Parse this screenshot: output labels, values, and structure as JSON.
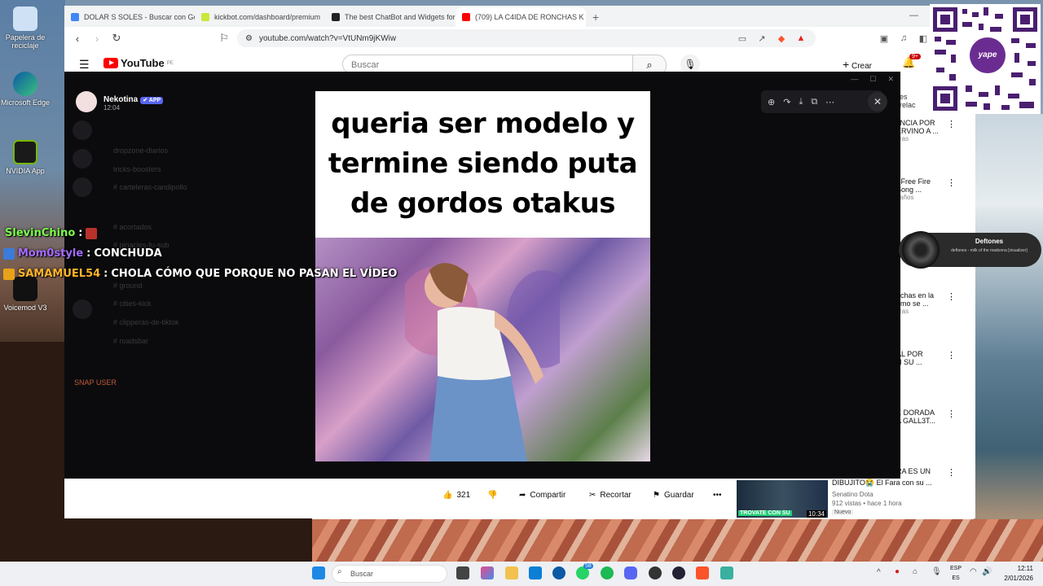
{
  "desktop": {
    "icons": [
      {
        "label": "Papelera de reciclaje"
      },
      {
        "label": "Microsoft Edge"
      },
      {
        "label": "NVIDIA App"
      },
      {
        "label": "Voicemod V3"
      }
    ]
  },
  "browser": {
    "tabs": [
      {
        "label": "DOLAR S SOLES - Buscar con Google",
        "color": "#4285f4"
      },
      {
        "label": "kickbot.com/dashboard/premium",
        "color": "#c8e83a"
      },
      {
        "label": "The best ChatBot and Widgets for K",
        "color": "#222222"
      },
      {
        "label": "(709) LA C4IDA DE RONCHAS K",
        "color": "#ff0000"
      }
    ],
    "new_tab": "+",
    "url": "youtube.com/watch?v=VtUNm9jKWiw"
  },
  "youtube": {
    "logo": "YouTube",
    "region": "PE",
    "search_placeholder": "Buscar",
    "create_label": "Crear",
    "bell_badge": "9+",
    "actions": {
      "likes": "321",
      "share": "Compartir",
      "clip": "Recortar",
      "save": "Guardar"
    },
    "recommendations": [
      {
        "title": "JNCIA POR\nERVINO A ...",
        "sub": "ras"
      },
      {
        "title": "- Free Fire\nSong ...",
        "sub": "años"
      },
      {
        "title": "nchas en la\nómo se ...",
        "sub": "ras"
      },
      {
        "title": "AL POR\nN SU ...",
        "sub": ""
      },
      {
        "title": "E DORADA\nA GALL3T...",
        "sub": ""
      },
      {
        "title": "RA ES UN",
        "sub": ""
      }
    ],
    "related_partial": "es relac",
    "mini_video": {
      "title": "DIBUJITO😭 El Fara con su ...",
      "channel": "Senatino Dota",
      "meta": "912 vistas • hace 1 hora",
      "badge": "Nuevo",
      "duration": "10:34",
      "thumb_text": "TROVATE CON SU"
    }
  },
  "discord": {
    "user": "Nekotina",
    "app_badge": "APP",
    "time": "12:04",
    "ghost_channels": [
      "dropzone-diarios",
      "tricks-boosters",
      "# carteleras-candipollo",
      "# acortados",
      "# pinacles-fu-sub",
      "# ground",
      "# cities-kick",
      "# clipperas-de-tiktok",
      "# roadsbar"
    ],
    "meme_caption": "queria ser modelo y termine siendo puta de gordos otakus"
  },
  "overlay_chat": [
    {
      "user": "SlevinChino",
      "sep": ":",
      "text": "",
      "color": "#7cff4c"
    },
    {
      "user": "Mom0style",
      "sep": ":",
      "text": "CONCHUDA",
      "color": "#a56bff"
    },
    {
      "user": "SAMAMUEL54",
      "sep": ":",
      "text": "CHOLA CÓMO QUE PORQUE NO PASAN EL VÍDEO",
      "color": "#ffb52b"
    }
  ],
  "snap_label": "SNAP USER",
  "yape_label": "yape",
  "deftones": {
    "title": "Deftones",
    "subtitle": "deftones - milk of the madonna [visualizer]"
  },
  "taskbar": {
    "search_placeholder": "Buscar",
    "lang_1": "ESP",
    "lang_2": "ES",
    "time": "12:11",
    "date": "2/01/2026",
    "whatsapp_badge": "58"
  }
}
